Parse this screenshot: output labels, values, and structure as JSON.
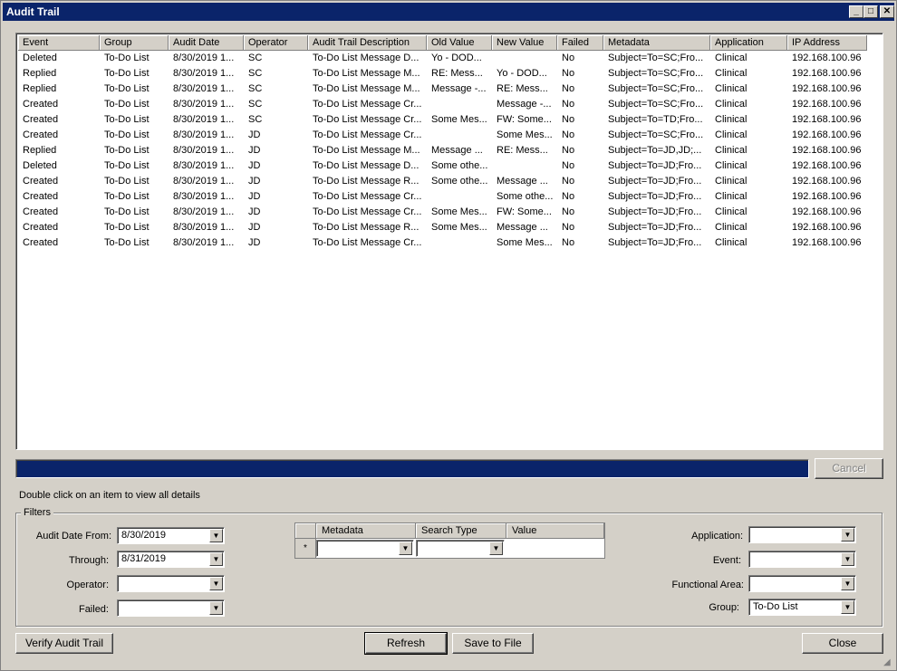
{
  "window": {
    "title": "Audit Trail"
  },
  "grid": {
    "columns": [
      "Event",
      "Group",
      "Audit Date",
      "Operator",
      "Audit Trail Description",
      "Old Value",
      "New Value",
      "Failed",
      "Metadata",
      "Application",
      "IP Address"
    ],
    "rows": [
      [
        "Deleted",
        "To-Do List",
        "8/30/2019 1...",
        "SC",
        "To-Do List Message D...",
        "Yo - DOD...",
        "",
        "No",
        "Subject=To=SC;Fro...",
        "Clinical",
        "192.168.100.96"
      ],
      [
        "Replied",
        "To-Do List",
        "8/30/2019 1...",
        "SC",
        "To-Do List Message M...",
        "RE: Mess...",
        "Yo - DOD...",
        "No",
        "Subject=To=SC;Fro...",
        "Clinical",
        "192.168.100.96"
      ],
      [
        "Replied",
        "To-Do List",
        "8/30/2019 1...",
        "SC",
        "To-Do List Message M...",
        "Message -...",
        "RE: Mess...",
        "No",
        "Subject=To=SC;Fro...",
        "Clinical",
        "192.168.100.96"
      ],
      [
        "Created",
        "To-Do List",
        "8/30/2019 1...",
        "SC",
        "To-Do List Message Cr...",
        "",
        "Message -...",
        "No",
        "Subject=To=SC;Fro...",
        "Clinical",
        "192.168.100.96"
      ],
      [
        "Created",
        "To-Do List",
        "8/30/2019 1...",
        "SC",
        "To-Do List Message Cr...",
        "Some Mes...",
        "FW: Some...",
        "No",
        "Subject=To=TD;Fro...",
        "Clinical",
        "192.168.100.96"
      ],
      [
        "Created",
        "To-Do List",
        "8/30/2019 1...",
        "JD",
        "To-Do List Message Cr...",
        "",
        "Some Mes...",
        "No",
        "Subject=To=SC;Fro...",
        "Clinical",
        "192.168.100.96"
      ],
      [
        "Replied",
        "To-Do List",
        "8/30/2019 1...",
        "JD",
        "To-Do List Message M...",
        "Message ...",
        "RE: Mess...",
        "No",
        "Subject=To=JD,JD;...",
        "Clinical",
        "192.168.100.96"
      ],
      [
        "Deleted",
        "To-Do List",
        "8/30/2019 1...",
        "JD",
        "To-Do List Message D...",
        "Some othe...",
        "",
        "No",
        "Subject=To=JD;Fro...",
        "Clinical",
        "192.168.100.96"
      ],
      [
        "Created",
        "To-Do List",
        "8/30/2019 1...",
        "JD",
        "To-Do List Message R...",
        "Some othe...",
        "Message ...",
        "No",
        "Subject=To=JD;Fro...",
        "Clinical",
        "192.168.100.96"
      ],
      [
        "Created",
        "To-Do List",
        "8/30/2019 1...",
        "JD",
        "To-Do List Message Cr...",
        "",
        "Some othe...",
        "No",
        "Subject=To=JD;Fro...",
        "Clinical",
        "192.168.100.96"
      ],
      [
        "Created",
        "To-Do List",
        "8/30/2019 1...",
        "JD",
        "To-Do List Message Cr...",
        "Some Mes...",
        "FW: Some...",
        "No",
        "Subject=To=JD;Fro...",
        "Clinical",
        "192.168.100.96"
      ],
      [
        "Created",
        "To-Do List",
        "8/30/2019 1...",
        "JD",
        "To-Do List Message R...",
        "Some Mes...",
        "Message ...",
        "No",
        "Subject=To=JD;Fro...",
        "Clinical",
        "192.168.100.96"
      ],
      [
        "Created",
        "To-Do List",
        "8/30/2019 1...",
        "JD",
        "To-Do List Message Cr...",
        "",
        "Some Mes...",
        "No",
        "Subject=To=JD;Fro...",
        "Clinical",
        "192.168.100.96"
      ]
    ]
  },
  "buttons": {
    "cancel": "Cancel",
    "verify": "Verify Audit Trail",
    "refresh": "Refresh",
    "save": "Save to File",
    "close": "Close"
  },
  "hint": "Double click on an item to view all details",
  "filters": {
    "legend": "Filters",
    "audit_date_from_label": "Audit Date From:",
    "audit_date_from_value": "8/30/2019",
    "through_label": "Through:",
    "through_value": "8/31/2019",
    "operator_label": "Operator:",
    "operator_value": "",
    "failed_label": "Failed:",
    "failed_value": "",
    "metadata_columns": [
      "Metadata",
      "Search Type",
      "Value"
    ],
    "new_row_marker": "*",
    "application_label": "Application:",
    "application_value": "",
    "event_label": "Event:",
    "event_value": "",
    "functional_area_label": "Functional Area:",
    "functional_area_value": "",
    "group_label": "Group:",
    "group_value": "To-Do List"
  },
  "colors": {
    "titlebar": "#0a246a",
    "window_bg": "#d4d0c8",
    "progress": "#0a246a"
  },
  "icons": {
    "minimize": "minimize-icon",
    "maximize": "maximize-icon",
    "close": "close-icon",
    "dropdown": "chevron-down-icon"
  }
}
